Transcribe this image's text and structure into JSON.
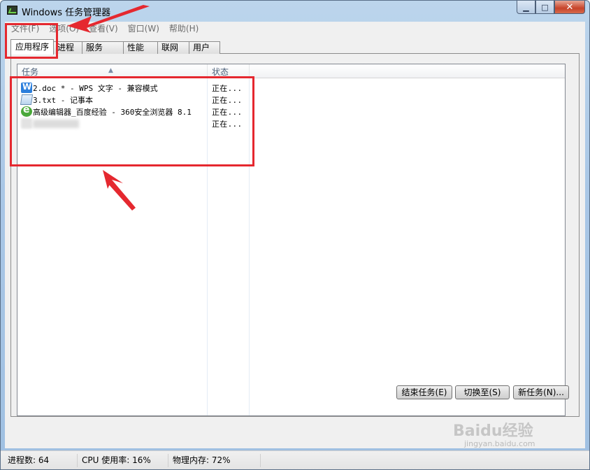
{
  "window": {
    "title": "Windows 任务管理器",
    "controls": {
      "minimize": "▁",
      "maximize": "□",
      "close": "✕"
    }
  },
  "menu": [
    "文件(F)",
    "选项(O)",
    "查看(V)",
    "窗口(W)",
    "帮助(H)"
  ],
  "tabs": [
    "应用程序",
    "进程",
    "服务",
    "性能",
    "联网",
    "用户"
  ],
  "active_tab": "应用程序",
  "list": {
    "columns": [
      "任务",
      "状态"
    ],
    "rows": [
      {
        "icon": "wps-writer-icon",
        "name": "2.doc * - WPS 文字 - 兼容模式",
        "status": "正在..."
      },
      {
        "icon": "notepad-icon",
        "name": "3.txt - 记事本",
        "status": "正在..."
      },
      {
        "icon": "360-browser-icon",
        "name": "高级编辑器_百度经验 - 360安全浏览器 8.1",
        "status": "正在..."
      },
      {
        "icon": "blurred-app-icon",
        "name": "",
        "status": "正在..."
      }
    ]
  },
  "buttons": {
    "end_task": "结束任务(E)",
    "switch_to": "切换至(S)",
    "new_task": "新任务(N)..."
  },
  "status_bar": {
    "processes": "进程数: 64",
    "cpu": "CPU 使用率: 16%",
    "memory": "物理内存: 72%"
  },
  "watermark": {
    "logo": "Baidu经验",
    "url": "jingyan.baidu.com"
  },
  "colors": {
    "annotation": "#e5282f",
    "title_bar": "#a9c7e6",
    "close_button": "#c7432a"
  }
}
